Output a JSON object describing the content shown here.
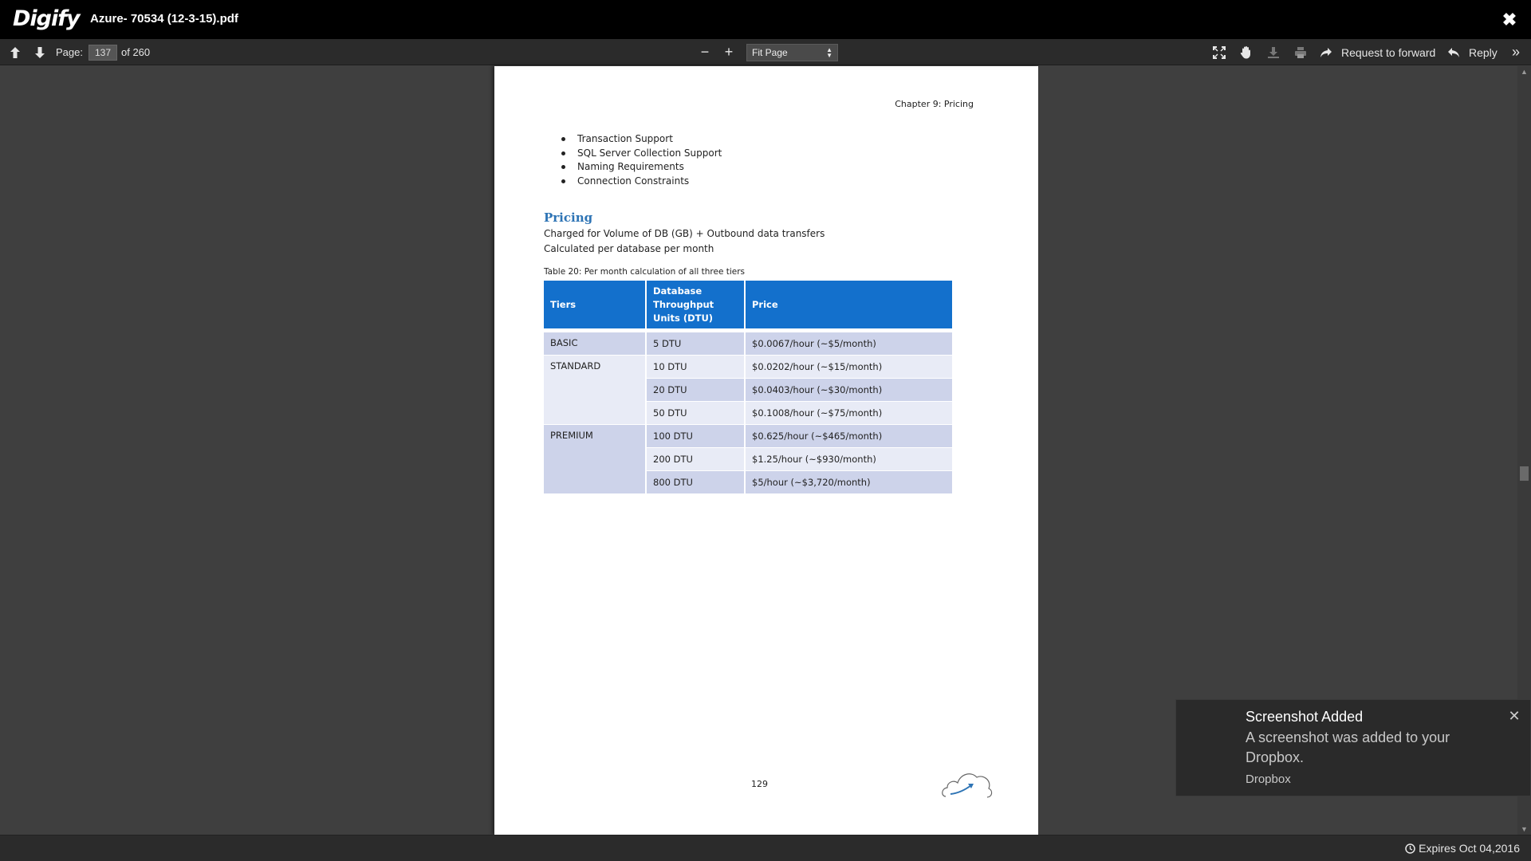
{
  "app": {
    "logo": "Digify",
    "document_title": "Azure- 70534 (12-3-15).pdf"
  },
  "toolbar": {
    "page_label": "Page:",
    "page_current": "137",
    "page_total_text": "of 260",
    "zoom_value": "Fit Page",
    "request_forward_label": "Request to forward",
    "reply_label": "Reply"
  },
  "pdf_page": {
    "chapter_header": "Chapter 9: Pricing",
    "bullets": [
      "Transaction Support",
      "SQL Server Collection Support",
      "Naming Requirements",
      "Connection Constraints"
    ],
    "heading": "Pricing",
    "line1": "Charged for Volume of DB (GB) + Outbound data transfers",
    "line2": "Calculated per database per month",
    "table_caption": "Table 20: Per month calculation of all three tiers",
    "table": {
      "headers": [
        "Tiers",
        "Database Throughput Units (DTU)",
        "Price"
      ],
      "tiers": {
        "basic": "BASIC",
        "standard": "STANDARD",
        "premium": "PREMIUM"
      },
      "rows": [
        {
          "dtu": "5 DTU",
          "price": "$0.0067/hour (~$5/month)"
        },
        {
          "dtu": "10 DTU",
          "price": "$0.0202/hour (~$15/month)"
        },
        {
          "dtu": "20 DTU",
          "price": "$0.0403/hour (~$30/month)"
        },
        {
          "dtu": "50 DTU",
          "price": "$0.1008/hour (~$75/month)"
        },
        {
          "dtu": "100 DTU",
          "price": "$0.625/hour (~$465/month)"
        },
        {
          "dtu": "200 DTU",
          "price": "$1.25/hour (~$930/month)"
        },
        {
          "dtu": "800 DTU",
          "price": "$5/hour (~$3,720/month)"
        }
      ]
    },
    "page_number": "129"
  },
  "toast": {
    "title": "Screenshot Added",
    "body": "A screenshot was added to your Dropbox.",
    "source": "Dropbox"
  },
  "statusbar": {
    "expiry": "Expires Oct 04,2016"
  },
  "colors": {
    "accent_blue": "#1370cc",
    "heading_blue": "#2e74b5",
    "row_dark": "#cdd3ea",
    "row_light": "#e8ebf6"
  }
}
